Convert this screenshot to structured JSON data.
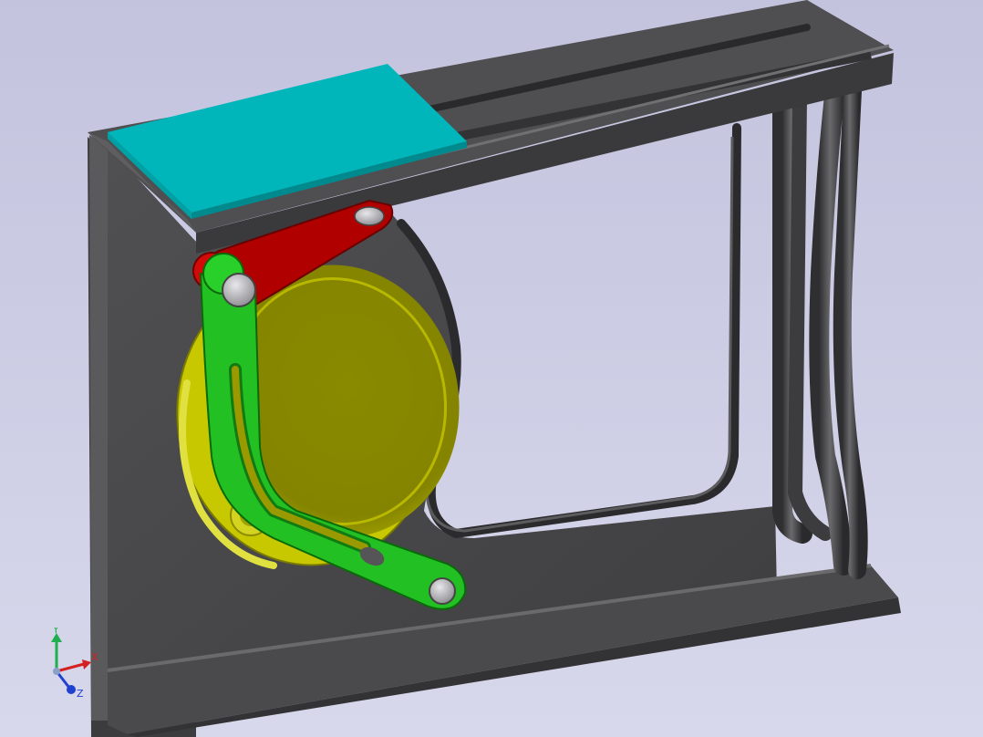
{
  "viewport": {
    "background_top": "#c3c3de",
    "background_bottom": "#d8d8ec"
  },
  "model": {
    "parts": [
      {
        "name": "frame-bracket",
        "color": "#4a4a4c"
      },
      {
        "name": "slider-block",
        "color": "#00b4b8"
      },
      {
        "name": "crank-link",
        "color": "#b00000"
      },
      {
        "name": "connecting-link",
        "color": "#1fbf1f"
      },
      {
        "name": "cam-disc",
        "color": "#b3b300"
      },
      {
        "name": "pipe-rods",
        "color": "#454547"
      }
    ]
  },
  "triad": {
    "y_label": "Y",
    "x_label": "X",
    "z_label": "Z",
    "x_color": "#d42020",
    "y_color": "#1faf4f",
    "z_color": "#2040d0"
  }
}
